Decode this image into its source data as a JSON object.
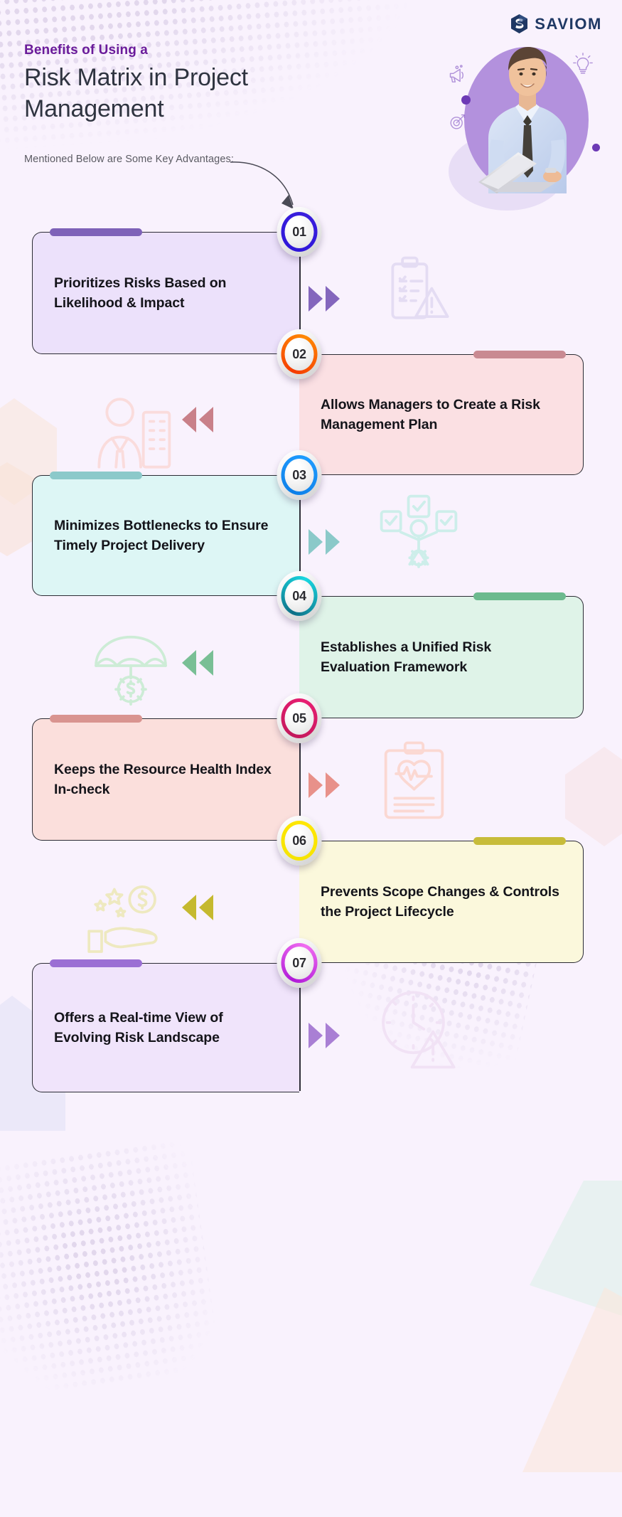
{
  "brand": {
    "logo_text": "SAVIOM",
    "logo_icon": "saviom-s-mark-icon",
    "logo_color": "#1f3864"
  },
  "header": {
    "eyebrow": "Benefits of Using a",
    "title": "Risk Matrix in Project Management",
    "subtitle": "Mentioned Below are Some Key Advantages:",
    "eyebrow_color": "#6a1b9a",
    "title_color": "#2f3440",
    "hero_icons": [
      "megaphone-icon",
      "lightbulb-idea-icon",
      "target-dart-icon"
    ],
    "hero_image": "businessman-with-laptop-photo",
    "arrow": "curved-arrow-icon"
  },
  "background": {
    "page_color": "#f9f2fd",
    "halftone_color": "#ded3ea"
  },
  "timeline": {
    "spine_color": "#2f2f38",
    "items": [
      {
        "number": "01",
        "text": "Prioritizes Risks Based on Likelihood & Impact",
        "side": "left",
        "bg": "#ece1fb",
        "tab": "#7e62b8",
        "chevron": "#8466bd",
        "ring": "#2e16d9",
        "ring_alt": "#3a1fdd",
        "watermark": "clipboard-warning-icon",
        "watermark_color": "#e4dcf3"
      },
      {
        "number": "02",
        "text": "Allows Managers to Create a Risk Management Plan",
        "side": "right",
        "bg": "#fbe0e3",
        "tab": "#c98a92",
        "chevron": "#c98089",
        "ring": "#f53b00",
        "ring_alt": "#ff8a00",
        "watermark": "manager-person-building-icon",
        "watermark_color": "#fadcdc"
      },
      {
        "number": "03",
        "text": "Minimizes Bottlenecks to Ensure Timely Project Delivery",
        "side": "left",
        "bg": "#ddf6f5",
        "tab": "#8cc9ca",
        "chevron": "#8bc9c9",
        "ring": "#0d7fe8",
        "ring_alt": "#1f9dff",
        "watermark": "team-checklist-gear-icon",
        "watermark_color": "#cdeeea"
      },
      {
        "number": "04",
        "text": "Establishes a Unified Risk Evaluation Framework",
        "side": "right",
        "bg": "#dff3e8",
        "tab": "#6cba8e",
        "chevron": "#79bf95",
        "ring": "#0e6f86",
        "ring_alt": "#18d7e0",
        "watermark": "umbrella-money-gear-icon",
        "watermark_color": "#cdecd6"
      },
      {
        "number": "05",
        "text": "Keeps the Resource Health Index In-check",
        "side": "left",
        "bg": "#fbdfdc",
        "tab": "#d99490",
        "chevron": "#e8918a",
        "ring": "#c2185b",
        "ring_alt": "#e81e72",
        "watermark": "clipboard-heartbeat-icon",
        "watermark_color": "#fbd8d2"
      },
      {
        "number": "06",
        "text": "Prevents Scope Changes & Controls the Project Lifecycle",
        "side": "right",
        "bg": "#fbf8dc",
        "tab": "#c7bc3a",
        "chevron": "#c5b92f",
        "ring": "#f5e400",
        "ring_alt": "#ffe600",
        "watermark": "hand-coin-stars-icon",
        "watermark_color": "#eee9c0"
      },
      {
        "number": "07",
        "text": "Offers a Real-time View of Evolving Risk Landscape",
        "side": "left",
        "bg": "#f0e4fb",
        "tab": "#9b6fd4",
        "chevron": "#a97fd4",
        "ring": "#b01ad8",
        "ring_alt": "#f06ef0",
        "watermark": "clock-warning-icon",
        "watermark_color": "#f1e2f5"
      }
    ]
  }
}
